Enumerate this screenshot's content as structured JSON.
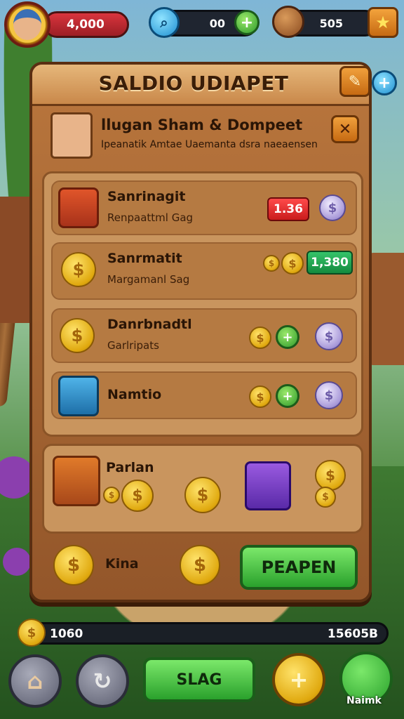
{
  "hud": {
    "player_score": "4,000",
    "gems": "00",
    "coins": "505"
  },
  "panel": {
    "title": "SALDIO UDIAPET",
    "profile_name": "llugan Sham & Dompeet",
    "profile_sub": "Ipeanatik Amtae Uaemanta dsra naeaensen"
  },
  "rows": [
    {
      "title": "Sanrinagit",
      "sub": "Renpaattml Gag",
      "price": "1.36"
    },
    {
      "title": "Sanrmatit",
      "sub": "Margamanl Sag",
      "price": "1,380"
    },
    {
      "title": "Danrbnadtl",
      "sub": "Garlripats"
    },
    {
      "title": "Namtio"
    }
  ],
  "rewards": {
    "title": "Parlan"
  },
  "bottom": {
    "label": "Kina",
    "button": "PEAPEN"
  },
  "bar": {
    "left_value": "1060",
    "right_value": "15605B"
  },
  "nav": {
    "center_button": "SLAG",
    "right_label": "Naimk"
  },
  "icons": {
    "coin_symbol": "$",
    "plus": "+",
    "close": "✕",
    "star": "★",
    "edit": "✎",
    "search": "⌕",
    "home": "⌂",
    "refresh": "↻"
  },
  "colors": {
    "panel": "#b9763d",
    "accent_green": "#2aa12c",
    "accent_red": "#c91c1c",
    "gold": "#e0a90f"
  }
}
